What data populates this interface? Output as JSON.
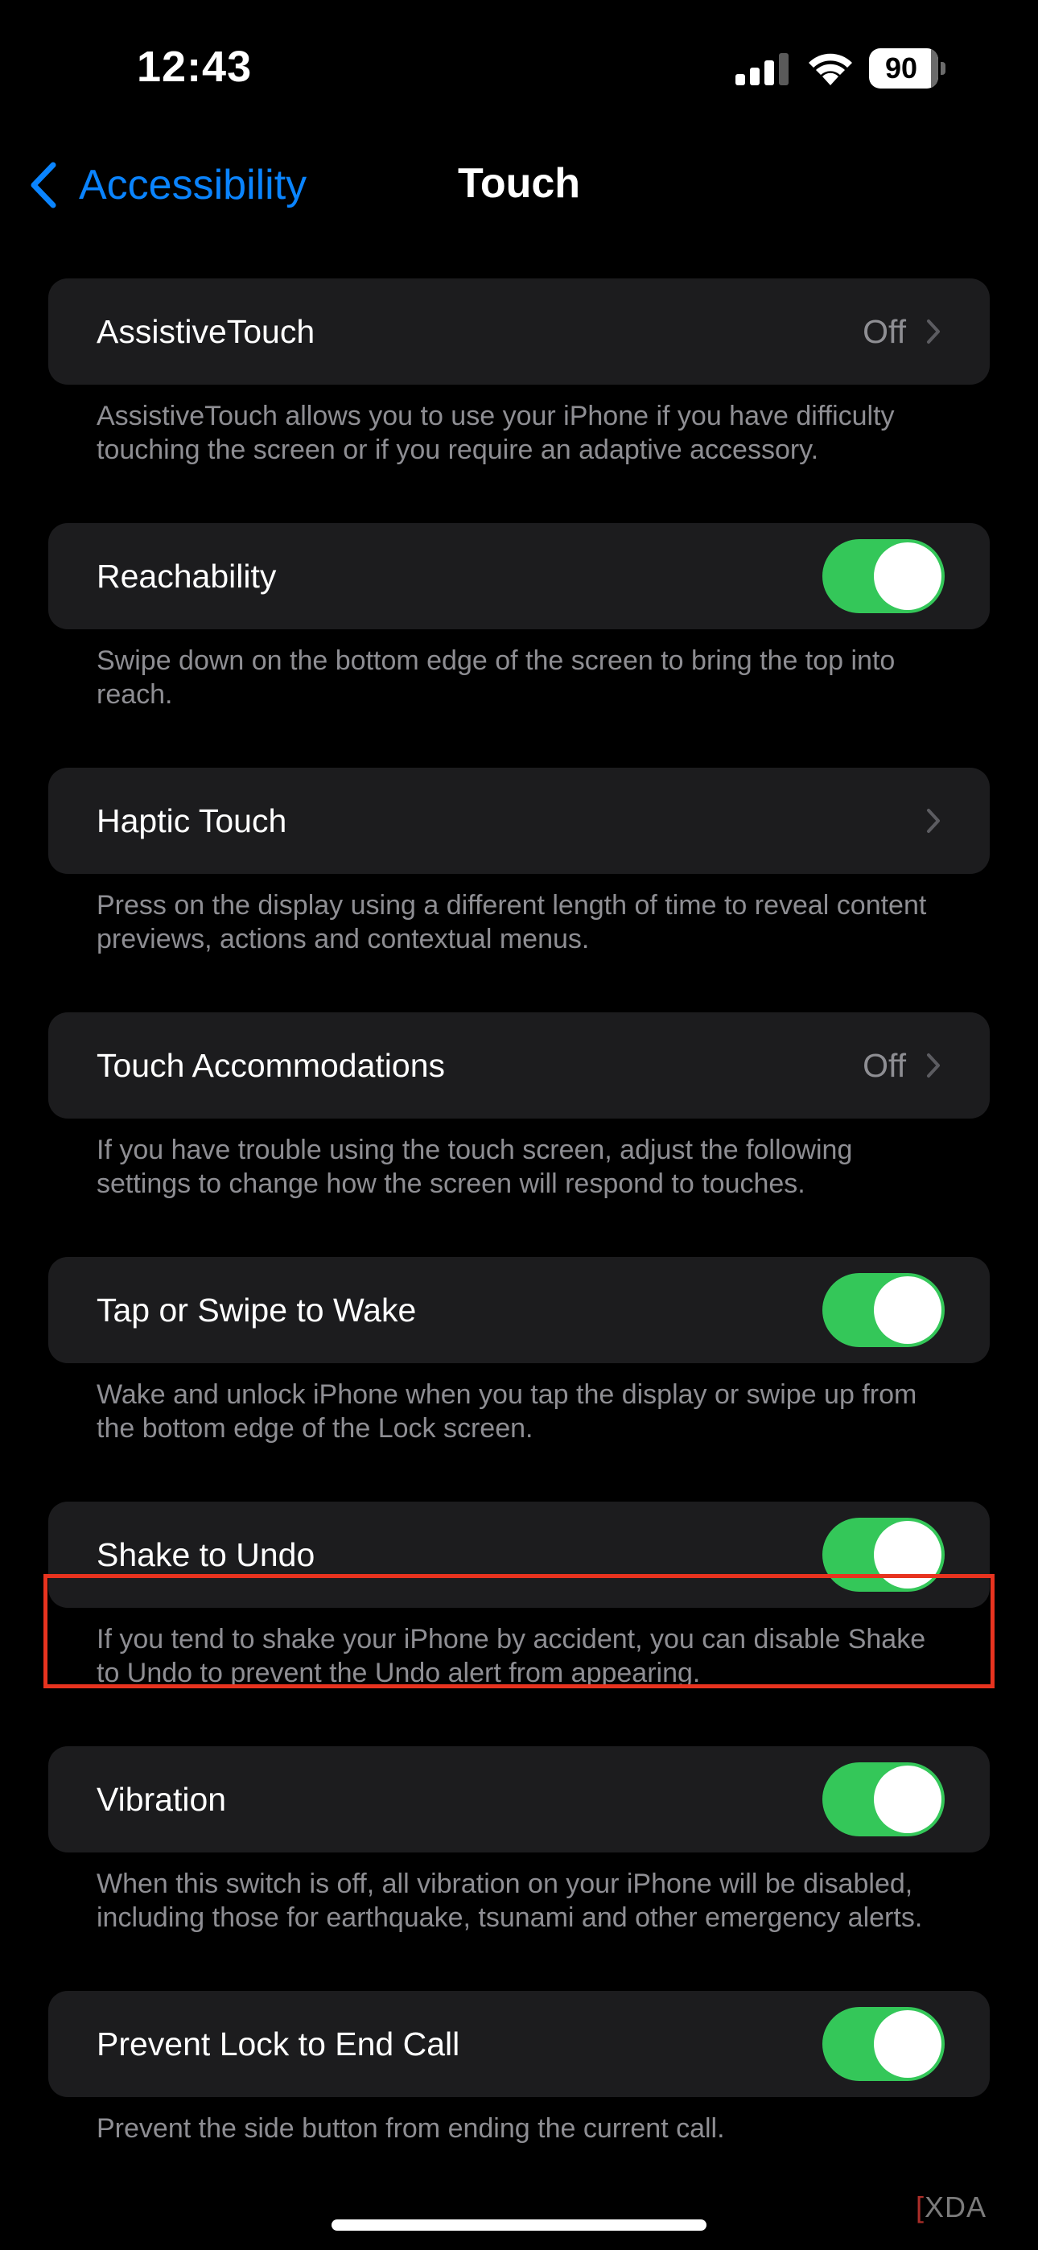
{
  "status_bar": {
    "time": "12:43",
    "battery_percent": "90",
    "icons": [
      "cellular-signal-icon",
      "wifi-icon",
      "battery-icon"
    ]
  },
  "nav": {
    "back_label": "Accessibility",
    "title": "Touch"
  },
  "settings": [
    {
      "label": "AssistiveTouch",
      "control": "disclosure",
      "value": "Off",
      "footer": "AssistiveTouch allows you to use your iPhone if you have difficulty touching the screen or if you require an adaptive accessory."
    },
    {
      "label": "Reachability",
      "control": "toggle",
      "on": true,
      "footer": "Swipe down on the bottom edge of the screen to bring the top into reach."
    },
    {
      "label": "Haptic Touch",
      "control": "disclosure",
      "value": "",
      "footer": "Press on the display using a different length of time to reveal content previews, actions and contextual menus."
    },
    {
      "label": "Touch Accommodations",
      "control": "disclosure",
      "value": "Off",
      "footer": "If you have trouble using the touch screen, adjust the following settings to change how the screen will respond to touches."
    },
    {
      "label": "Tap or Swipe to Wake",
      "control": "toggle",
      "on": true,
      "footer": "Wake and unlock iPhone when you tap the display or swipe up from the bottom edge of the Lock screen."
    },
    {
      "label": "Shake to Undo",
      "control": "toggle",
      "on": true,
      "highlighted": true,
      "footer": "If you tend to shake your iPhone by accident, you can disable Shake to Undo to prevent the Undo alert from appearing."
    },
    {
      "label": "Vibration",
      "control": "toggle",
      "on": true,
      "footer": "When this switch is off, all vibration on your iPhone will be disabled, including those for earthquake, tsunami and other emergency alerts."
    },
    {
      "label": "Prevent Lock to End Call",
      "control": "toggle",
      "on": true,
      "footer": "Prevent the side button from ending the current call."
    }
  ],
  "watermark": {
    "text": "XDA"
  },
  "colors": {
    "background": "#000000",
    "cell_background": "#1c1c1e",
    "accent_blue": "#0a84ff",
    "toggle_on": "#34c759",
    "secondary_text": "#8e8e93",
    "highlight_border": "#e8331f"
  }
}
